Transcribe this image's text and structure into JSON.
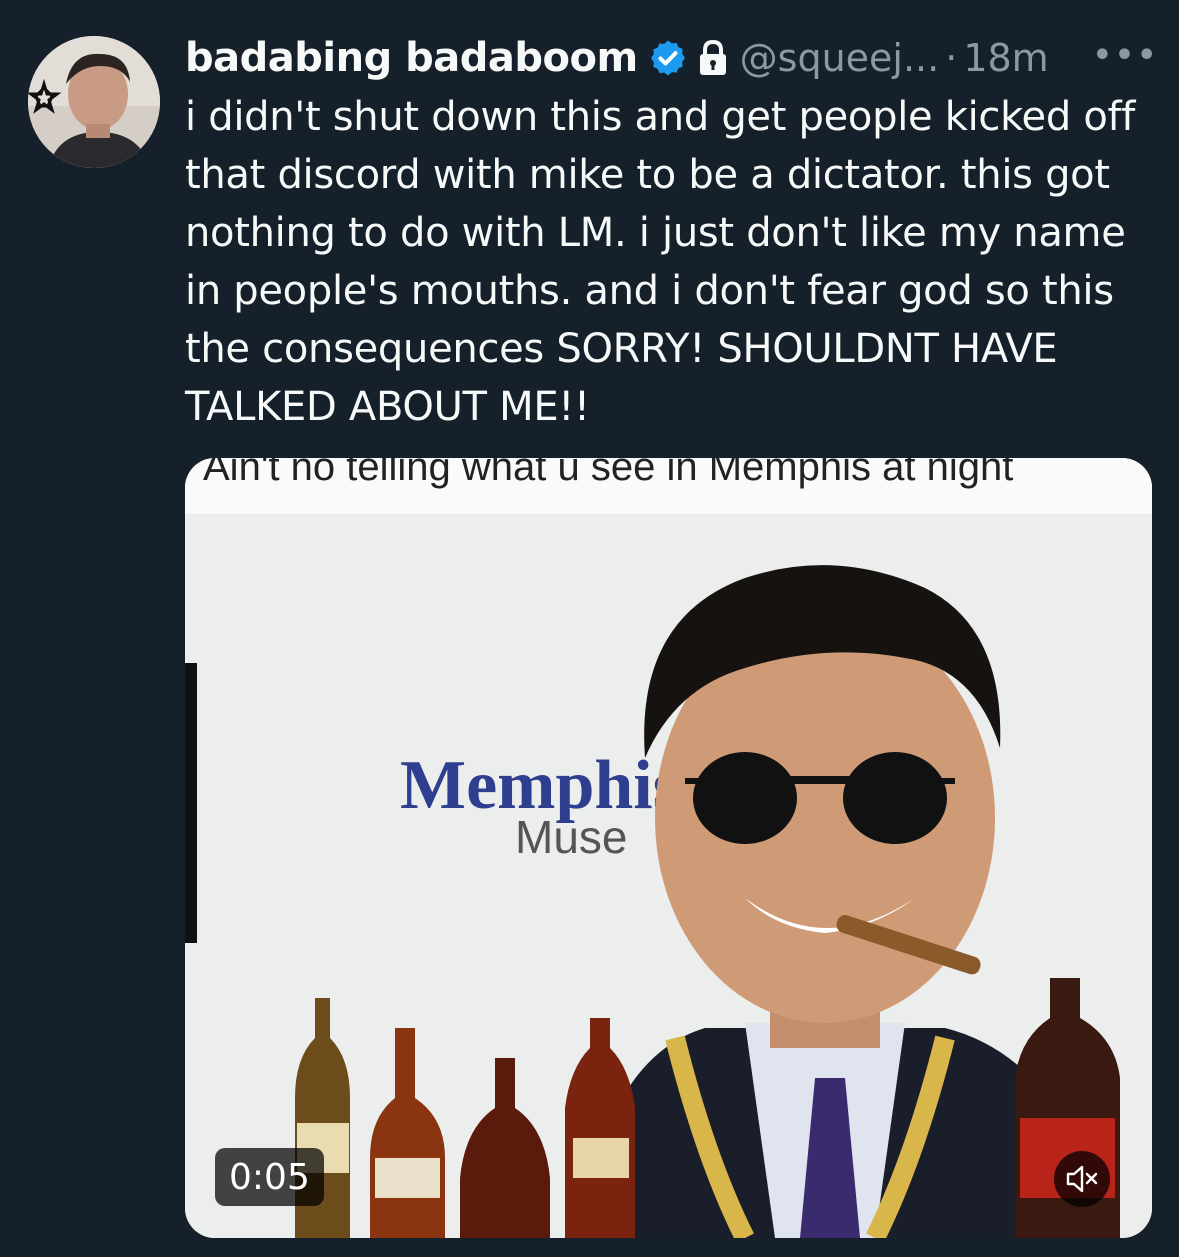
{
  "tweet": {
    "display_name": "badabing badaboom",
    "handle": "@squeej...",
    "separator": "·",
    "time": "18m",
    "more_label": "•••",
    "text_lines": [
      "i didn't shut down this and get people kicked off",
      "that discord with mike to be a dictator.  this got",
      "nothing to do with LM. i just don't like my name",
      "in people's mouths. and i don't fear god so this",
      "the consequences SORRY! SHOULDNT HAVE",
      "TALKED ABOUT ME!!"
    ]
  },
  "media": {
    "caption": "Ain't no telling what u see in Memphis at night",
    "sign_title": "Memphis",
    "sign_subtitle": "Muse",
    "timer": "0:05"
  },
  "icons": {
    "verified": "verified-badge-icon",
    "lock": "lock-icon",
    "more": "more-options-icon",
    "mute": "speaker-muted-icon"
  },
  "colors": {
    "background": "#15202b",
    "verified": "#1d9bf0",
    "secondary_text": "#8b98a5"
  }
}
